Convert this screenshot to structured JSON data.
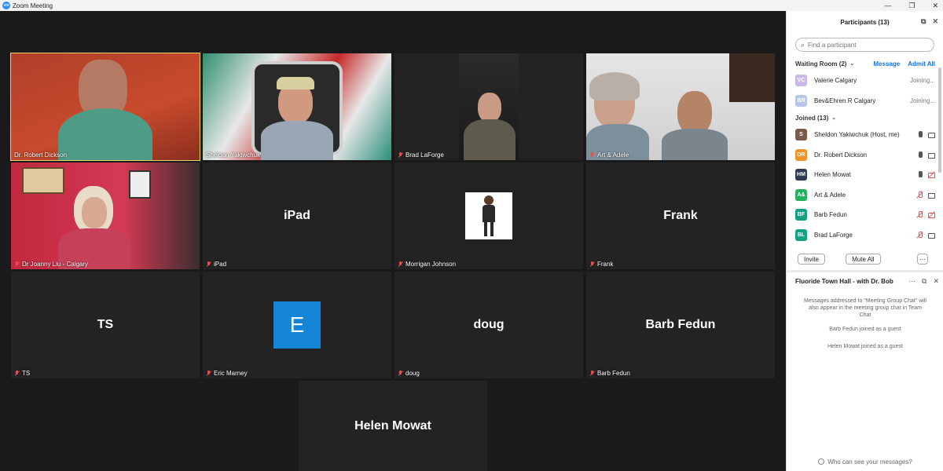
{
  "window": {
    "title": "Zoom Meeting",
    "minimize": "—",
    "restore": "❐",
    "close": "✕",
    "logo": "zm"
  },
  "tiles": [
    {
      "name": "Dr. Robert Dickson",
      "muted": false,
      "active": true
    },
    {
      "name": "Sheldon Yakiwchuk",
      "muted": false
    },
    {
      "name": "Brad LaForge",
      "muted": true
    },
    {
      "name": "Art & Adele",
      "muted": true
    },
    {
      "name": "Dr Joanny Liu - Calgary",
      "muted": true
    },
    {
      "name": "iPad",
      "muted": true,
      "big": "iPad"
    },
    {
      "name": "Morrigan Johnson",
      "muted": true
    },
    {
      "name": "Frank",
      "muted": true,
      "big": "Frank"
    },
    {
      "name": "TS",
      "muted": true,
      "big": "TS"
    },
    {
      "name": "Eric Marney",
      "muted": true,
      "avatar_letter": "E"
    },
    {
      "name": "doug",
      "muted": true,
      "big": "doug"
    },
    {
      "name": "Barb Fedun",
      "muted": true,
      "big": "Barb Fedun"
    },
    {
      "big": "Helen Mowat"
    }
  ],
  "participants": {
    "title": "Participants (13)",
    "search_placeholder": "Find a participant",
    "waiting": {
      "label": "Waiting Room (2)",
      "message": "Message",
      "admit_all": "Admit All"
    },
    "waiting_list": [
      {
        "initials": "VC",
        "name": "Valerie  Calgary",
        "status": "Joining...",
        "color": "#c9b8e8"
      },
      {
        "initials": "BR",
        "name": "Bev&Ehren R Calgary",
        "status": "Joining...",
        "color": "#b9c6e6"
      }
    ],
    "joined": {
      "label": "Joined (13)"
    },
    "joined_list": [
      {
        "initials": "S",
        "name": "Sheldon Yakiwchuk (Host, me)",
        "color": "#7a5a48",
        "mic": "on",
        "cam": "on"
      },
      {
        "initials": "DR",
        "name": "Dr. Robert Dickson",
        "color": "#f0932b",
        "mic": "on",
        "cam": "on"
      },
      {
        "initials": "HM",
        "name": "Helen Mowat",
        "color": "#2f3b52",
        "mic": "on",
        "cam": "off"
      },
      {
        "initials": "A&",
        "name": "Art & Adele",
        "color": "#27ae60",
        "mic": "off",
        "cam": "on"
      },
      {
        "initials": "BF",
        "name": "Barb Fedun",
        "color": "#16a085",
        "mic": "off",
        "cam": "off"
      },
      {
        "initials": "BL",
        "name": "Brad LaForge",
        "color": "#16a085",
        "mic": "off",
        "cam": "on"
      }
    ],
    "invite": "Invite",
    "mute_all": "Mute All",
    "more": "···"
  },
  "chat": {
    "title": "Fluoride Town Hall - with Dr. Bob",
    "more": "···",
    "notice": "Messages addressed to \"Meeting Group Chat\" will also appear in the meeting group chat in Team Chat",
    "events": [
      "Barb Fedun joined as a guest",
      "Helen Mowat joined as a guest"
    ],
    "footer": "Who can see your messages?"
  },
  "icons": {
    "popout": "⧉",
    "close": "✕",
    "search": "⌕",
    "chevron": "⌄"
  }
}
